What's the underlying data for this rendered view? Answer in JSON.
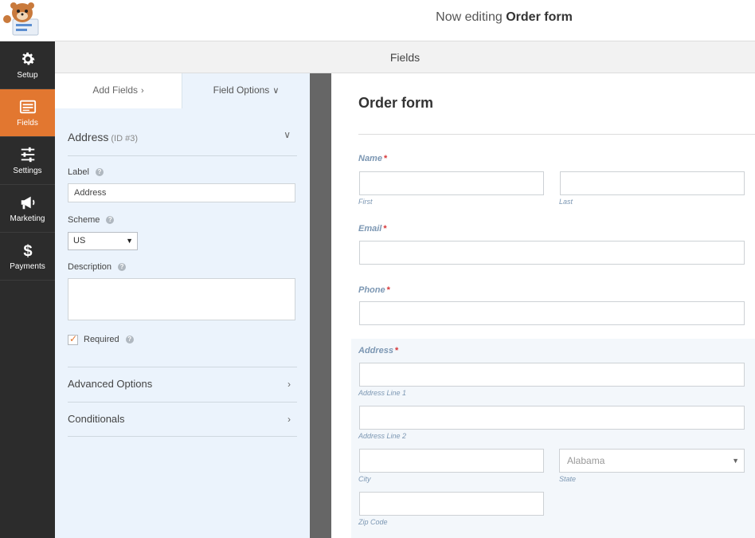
{
  "header": {
    "prefix": "Now editing",
    "form_name": "Order form"
  },
  "nav": [
    {
      "id": "setup",
      "label": "Setup",
      "icon": "gear-icon"
    },
    {
      "id": "fields",
      "label": "Fields",
      "icon": "fields-icon",
      "active": true
    },
    {
      "id": "settings",
      "label": "Settings",
      "icon": "sliders-icon"
    },
    {
      "id": "marketing",
      "label": "Marketing",
      "icon": "megaphone-icon"
    },
    {
      "id": "payments",
      "label": "Payments",
      "icon": "dollar-icon"
    }
  ],
  "fields_header": "Fields",
  "tabs": {
    "add_fields": "Add Fields",
    "field_options": "Field Options"
  },
  "field_options": {
    "section_title": "Address",
    "section_id": "(ID #3)",
    "label_caption": "Label",
    "label_value": "Address",
    "scheme_caption": "Scheme",
    "scheme_value": "US",
    "description_caption": "Description",
    "description_value": "",
    "required_caption": "Required",
    "required_checked": true,
    "advanced_options": "Advanced Options",
    "conditionals": "Conditionals"
  },
  "preview": {
    "form_title": "Order form",
    "required_mark": "*",
    "name_label": "Name",
    "name_first": "First",
    "name_last": "Last",
    "email_label": "Email",
    "phone_label": "Phone",
    "address_label": "Address",
    "address_line1": "Address Line 1",
    "address_line2": "Address Line 2",
    "city": "City",
    "state": "State",
    "state_value": "Alabama",
    "zip": "Zip Code"
  },
  "colors": {
    "accent": "#e27730",
    "sidebar": "#2c2c2c",
    "panel": "#ebf3fc",
    "label_blue": "#7c97b3"
  }
}
